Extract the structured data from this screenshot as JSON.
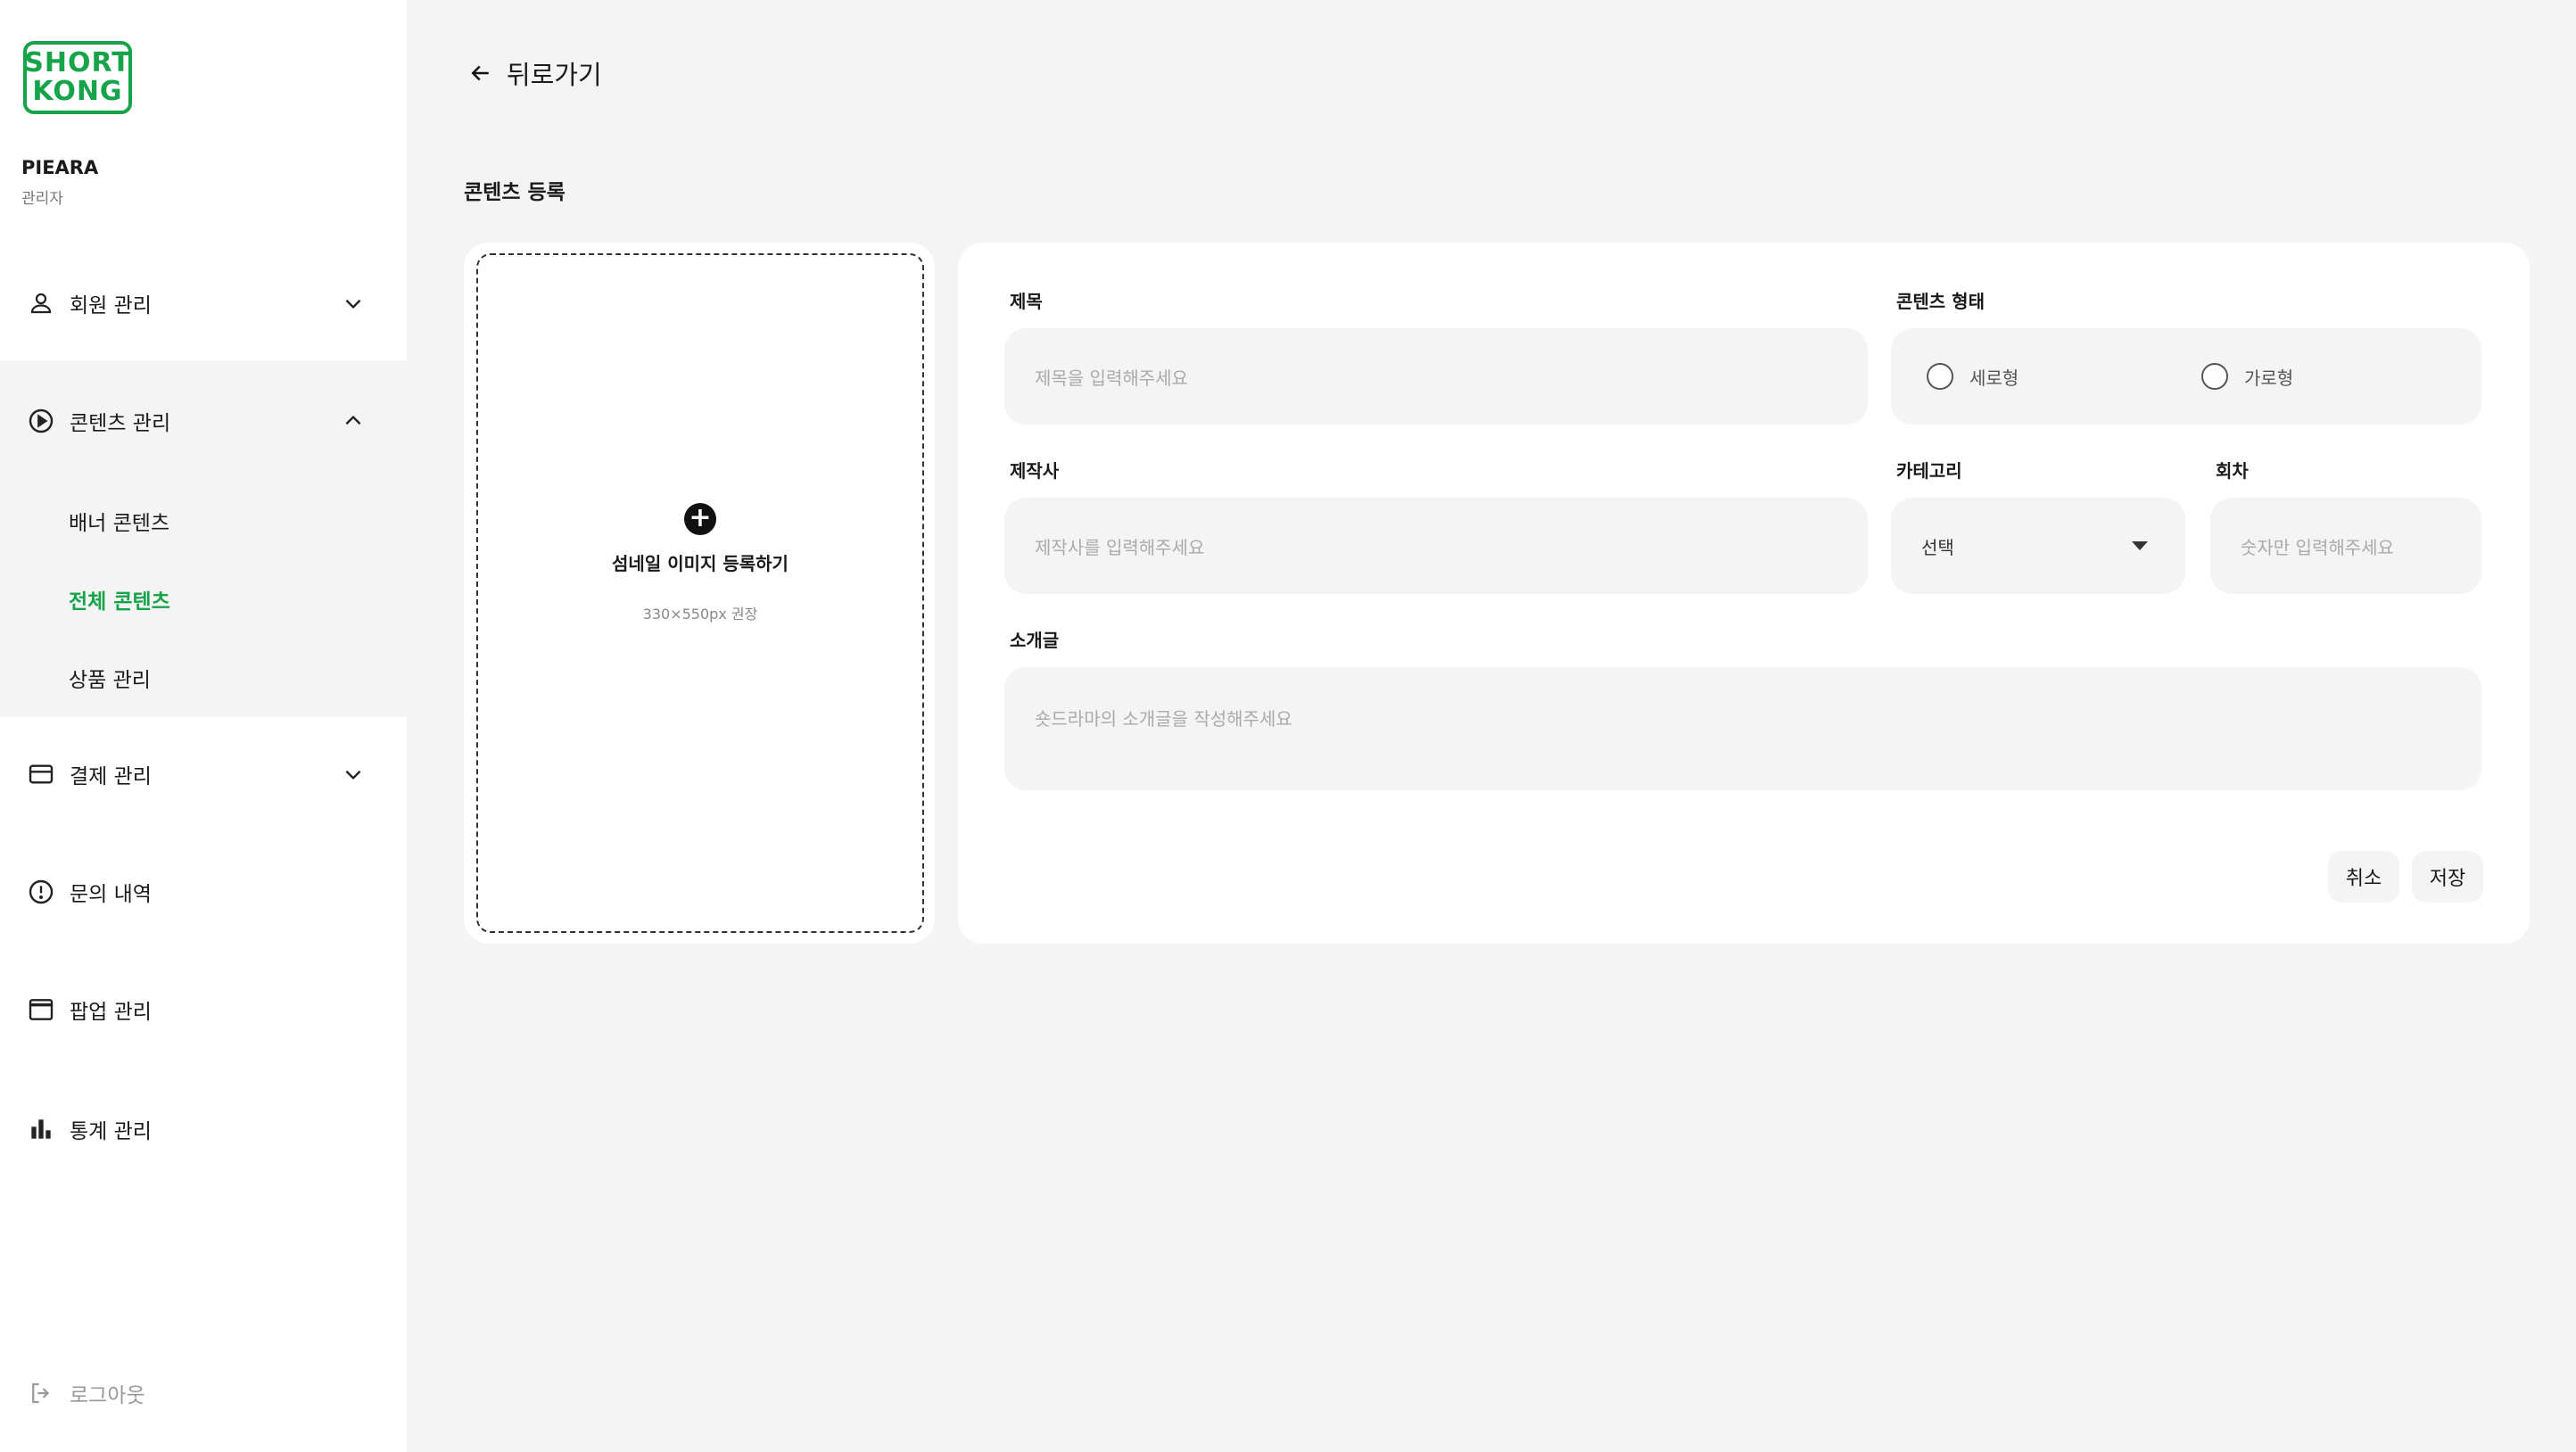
{
  "brand": {
    "logo_line1": "SHORT",
    "logo_line2": "KONG",
    "color": "#17a34a"
  },
  "profile": {
    "name": "PIEARA",
    "role": "관리자"
  },
  "sidebar": {
    "items": [
      {
        "label": "회원 관리",
        "icon": "person-icon",
        "expanded": false
      },
      {
        "label": "콘텐츠 관리",
        "icon": "play-circle-icon",
        "expanded": true
      },
      {
        "label": "결제 관리",
        "icon": "credit-card-icon",
        "expanded": false
      },
      {
        "label": "문의 내역",
        "icon": "alert-circle-icon"
      },
      {
        "label": "팝업 관리",
        "icon": "window-icon"
      },
      {
        "label": "통계 관리",
        "icon": "bar-chart-icon"
      }
    ],
    "sub_items": [
      {
        "label": "배너 콘텐츠",
        "active": false
      },
      {
        "label": "전체 콘텐츠",
        "active": true
      },
      {
        "label": "상품 관리",
        "active": false
      }
    ],
    "logout_label": "로그아웃"
  },
  "header": {
    "back_label": "뒤로가기"
  },
  "section_title": "콘텐츠 등록",
  "thumbnail": {
    "label": "섬네일 이미지 등록하기",
    "hint": "330×550px 권장"
  },
  "form": {
    "title": {
      "label": "제목",
      "placeholder": "제목을 입력해주세요"
    },
    "content_type": {
      "label": "콘텐츠 형태",
      "options": [
        "세로형",
        "가로형"
      ]
    },
    "producer": {
      "label": "제작사",
      "placeholder": "제작사를 입력해주세요"
    },
    "category": {
      "label": "카테고리",
      "value": "선택"
    },
    "episode": {
      "label": "회차",
      "placeholder": "숫자만 입력해주세요"
    },
    "intro": {
      "label": "소개글",
      "placeholder": "숏드라마의 소개글을 작성해주세요"
    },
    "cancel_label": "취소",
    "save_label": "저장"
  }
}
